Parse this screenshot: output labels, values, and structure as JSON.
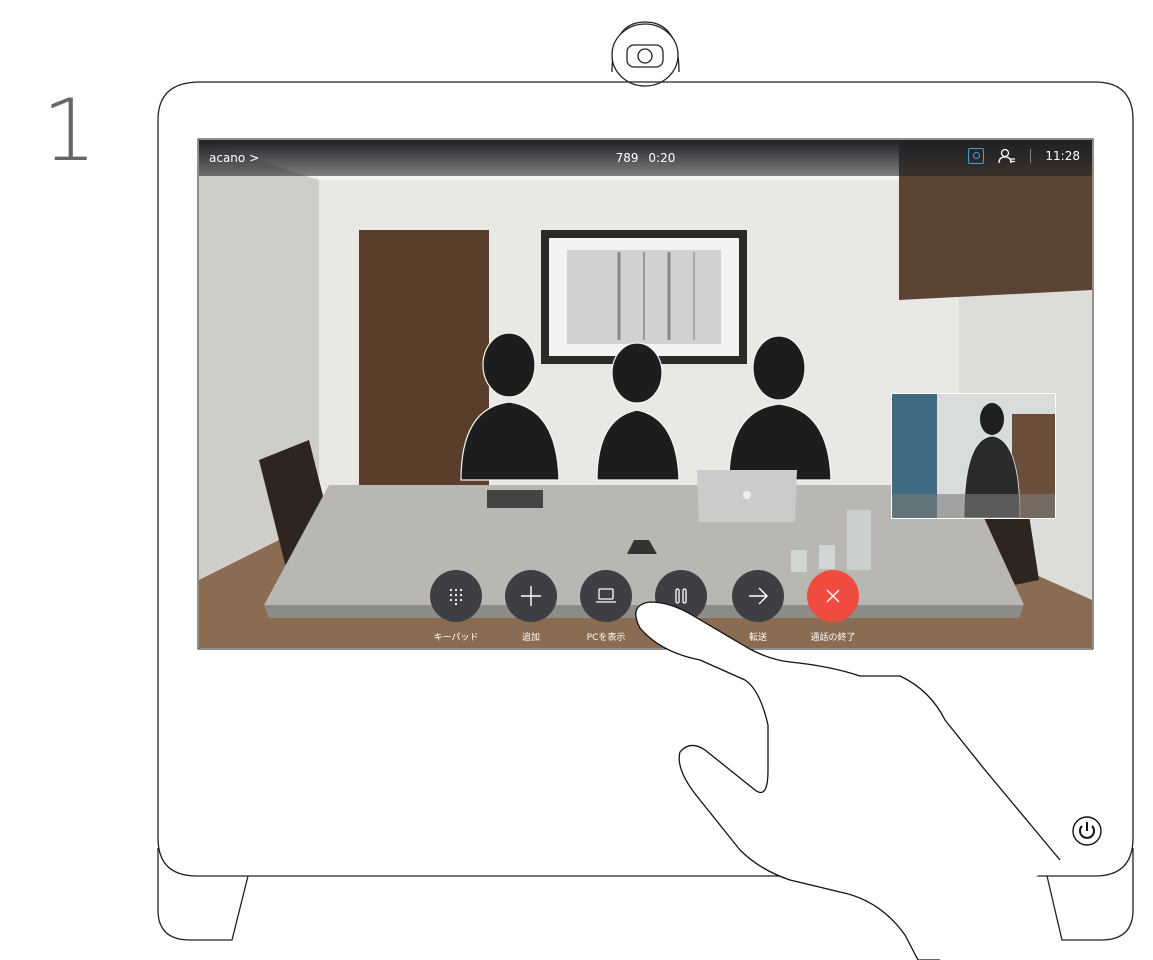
{
  "step": "1",
  "call": {
    "caller": "acano >",
    "number": "789",
    "duration": "0:20",
    "clock": "11:28"
  },
  "controls": [
    {
      "label": "キーパッド",
      "icon": "keypad-icon"
    },
    {
      "label": "追加",
      "icon": "plus-icon"
    },
    {
      "label": "PCを表示",
      "icon": "laptop-icon"
    },
    {
      "label": "",
      "icon": "pause-icon"
    },
    {
      "label": "転送",
      "icon": "arrow-right-icon"
    },
    {
      "label": "通話の終了",
      "icon": "close-icon"
    }
  ],
  "colors": {
    "end_call": "#ef4b3e",
    "button": "#3d3f44",
    "accent": "#3aa3d9"
  }
}
